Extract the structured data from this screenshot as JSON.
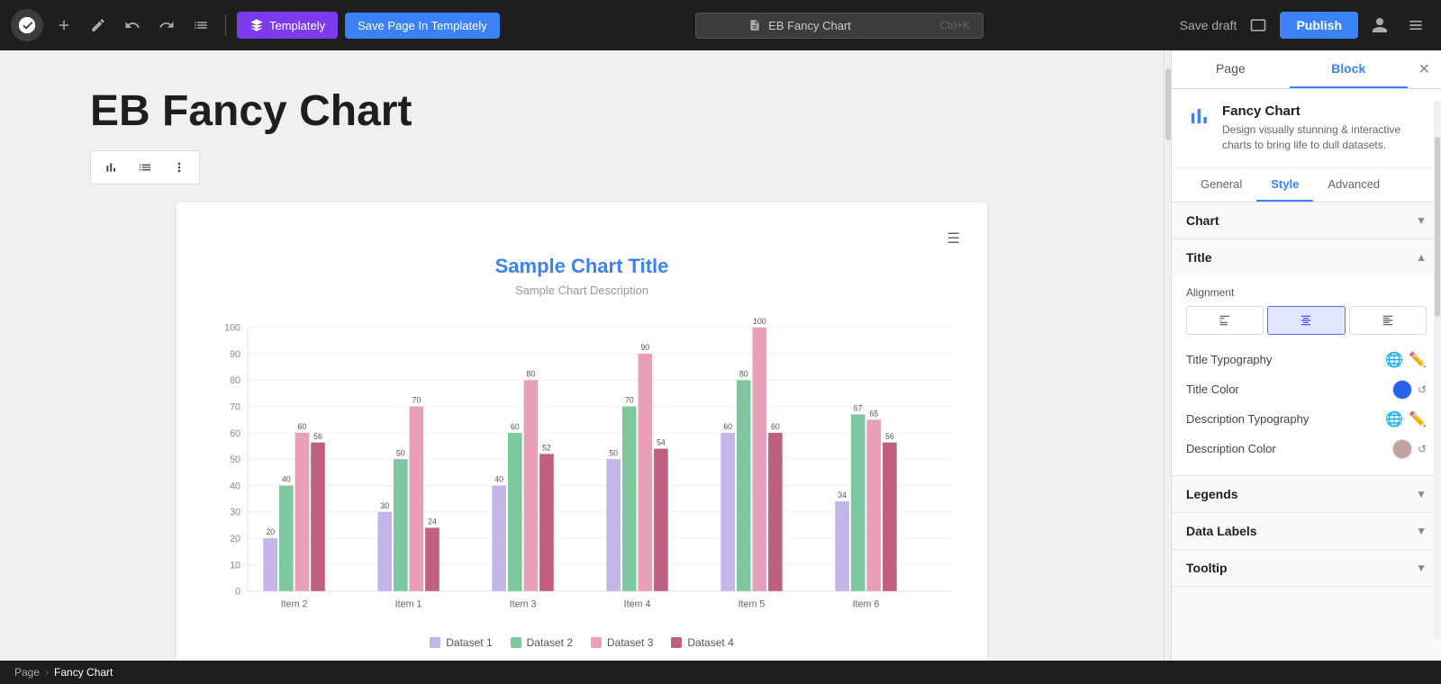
{
  "toolbar": {
    "templately_label": "Templately",
    "save_page_label": "Save Page In Templately",
    "search_placeholder": "EB Fancy Chart",
    "search_shortcut": "Ctrl+K",
    "save_draft_label": "Save draft",
    "publish_label": "Publish"
  },
  "canvas": {
    "page_title": "EB Fancy Chart",
    "block_toolbar": {
      "chart_icon": "chart",
      "align_icon": "align",
      "more_icon": "more"
    },
    "chart": {
      "title": "Sample Chart Title",
      "description": "Sample Chart Description",
      "y_axis": [
        100,
        90,
        80,
        70,
        60,
        50,
        40,
        30,
        20,
        10,
        0
      ],
      "x_labels": [
        "Item 2",
        "Item 1",
        "Item 3",
        "Item 4",
        "Item 5",
        "Item 6"
      ],
      "legend": [
        {
          "label": "Dataset 1",
          "color": "#b8a9e0"
        },
        {
          "label": "Dataset 2",
          "color": "#7ec8a0"
        },
        {
          "label": "Dataset 3",
          "color": "#e8a0b8"
        },
        {
          "label": "Dataset 4",
          "color": "#c06080"
        }
      ],
      "datasets": {
        "item2": [
          20,
          40,
          60,
          56
        ],
        "item1": [
          30,
          50,
          70,
          24
        ],
        "item3": [
          40,
          60,
          80,
          52
        ],
        "item4": [
          50,
          70,
          90,
          54
        ],
        "item5": [
          60,
          80,
          100,
          60
        ],
        "item6": [
          34,
          67,
          65,
          56
        ]
      }
    }
  },
  "right_panel": {
    "tab_page": "Page",
    "tab_block": "Block",
    "plugin_name": "Fancy Chart",
    "plugin_desc": "Design visually stunning & interactive charts to bring life to dull datasets.",
    "sub_tabs": {
      "general": "General",
      "style": "Style",
      "advanced": "Advanced"
    },
    "sections": {
      "chart": "Chart",
      "title": "Title",
      "alignment_label": "Alignment",
      "title_typography": "Title Typography",
      "title_color": "Title Color",
      "title_color_value": "#2563eb",
      "description_typography": "Description Typography",
      "description_color": "Description Color",
      "description_color_value": "#c4a0a0",
      "legends": "Legends",
      "data_labels": "Data Labels",
      "tooltip": "Tooltip"
    }
  },
  "breadcrumb": {
    "page": "Page",
    "separator": "›",
    "current": "Fancy Chart"
  }
}
